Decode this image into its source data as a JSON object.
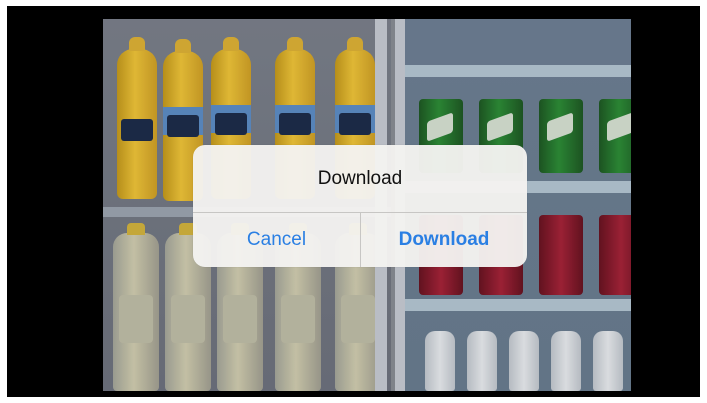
{
  "dialog": {
    "title": "Download",
    "cancel_label": "Cancel",
    "confirm_label": "Download"
  },
  "colors": {
    "accent": "#2a7fe3",
    "frame": "#000000"
  }
}
